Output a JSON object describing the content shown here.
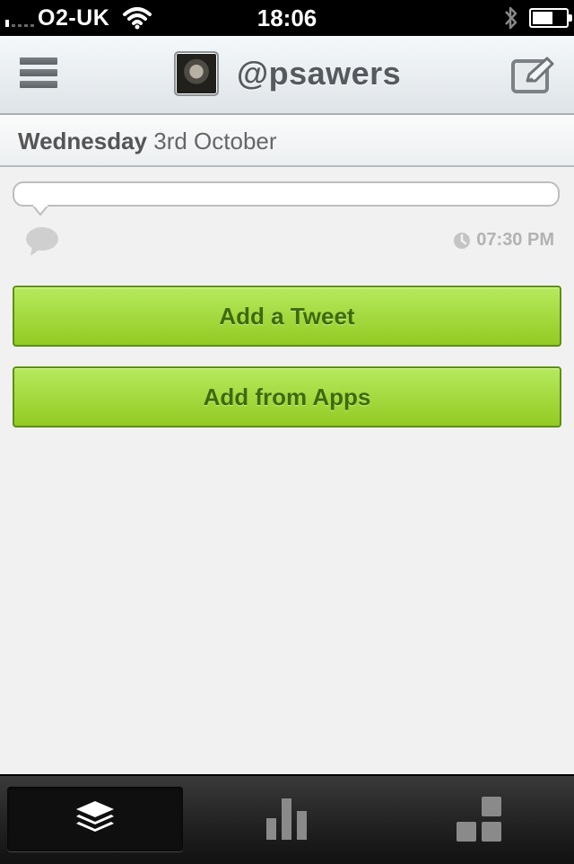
{
  "status_bar": {
    "carrier": "O2-UK",
    "time": "18:06",
    "signal_bars_filled": 1,
    "battery_level_percent": 60
  },
  "nav": {
    "handle": "@psawers",
    "icons": {
      "menu": "hamburger-icon",
      "compose": "compose-icon"
    }
  },
  "date_header": {
    "day": "Wednesday",
    "date": "3rd October"
  },
  "slot": {
    "time": "07:30 PM",
    "icons": {
      "comment": "comment-icon",
      "clock": "clock-icon"
    }
  },
  "buttons": {
    "add_tweet": "Add a Tweet",
    "add_from_apps": "Add from Apps"
  },
  "tabs": [
    {
      "icon": "layers-icon",
      "active": true
    },
    {
      "icon": "bar-chart-icon",
      "active": false
    },
    {
      "icon": "blocks-icon",
      "active": false
    }
  ],
  "colors": {
    "button_green": "#a4d940",
    "button_text": "#3f6a0c",
    "background": "#f1f1f1"
  }
}
